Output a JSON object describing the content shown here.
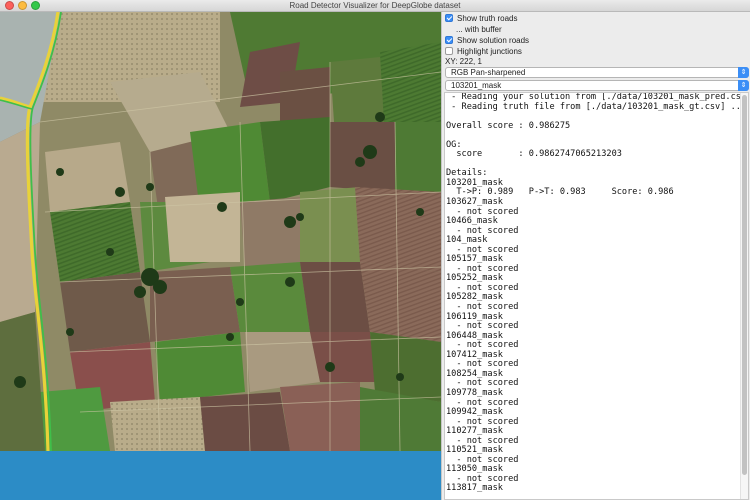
{
  "window": {
    "title": "Road Detector Visualizer for DeepGlobe dataset"
  },
  "controls": {
    "show_truth_roads": {
      "label": "Show truth roads",
      "checked": true
    },
    "with_buffer": {
      "label": "... with buffer",
      "checked": false
    },
    "show_solution_roads": {
      "label": "Show solution roads",
      "checked": true
    },
    "highlight_junctions": {
      "label": "Highlight junctions",
      "checked": false
    },
    "xy_readout": "XY: 222, 1",
    "image_mode_select": {
      "value": "RGB Pan-sharpened"
    },
    "image_select": {
      "value": "103201_mask"
    }
  },
  "log": {
    "lines": [
      " - Reading your solution from [./data/103201_mask_pred.csv]",
      " - Reading truth file from [./data/103201_mask_gt.csv] ...",
      "",
      "Overall score : 0.986275",
      "",
      "OG:",
      "  score       : 0.9862747065213203",
      "",
      "Details:",
      "103201_mask",
      "  T->P: 0.989   P->T: 0.983     Score: 0.986",
      "103627_mask",
      "  - not scored",
      "10466_mask",
      "  - not scored",
      "104_mask",
      "  - not scored",
      "105157_mask",
      "  - not scored",
      "105252_mask",
      "  - not scored",
      "105282_mask",
      "  - not scored",
      "106119_mask",
      "  - not scored",
      "106448_mask",
      "  - not scored",
      "107412_mask",
      "  - not scored",
      "108254_mask",
      "  - not scored",
      "109778_mask",
      "  - not scored",
      "109942_mask",
      "  - not scored",
      "110277_mask",
      "  - not scored",
      "110521_mask",
      "  - not scored",
      "113050_mask",
      "  - not scored",
      "113817_mask"
    ]
  },
  "colors": {
    "truth_road": "#e8d23a",
    "solution_road": "#3fbf4a",
    "checkbox_accent": "#3b8ef6",
    "bottom_fill": "#2c8cc6"
  },
  "icons": {
    "combo_arrow": "chevron-updown-icon"
  }
}
